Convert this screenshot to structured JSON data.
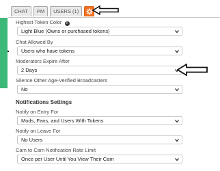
{
  "tabs": [
    {
      "label": "CHAT"
    },
    {
      "label": "PM"
    },
    {
      "label": "USERS (1)"
    },
    {
      "label": "",
      "icon": "gear-icon",
      "active": true,
      "color": "#f47321"
    }
  ],
  "settings": {
    "highest_token_color": {
      "label": "Highest Token Color",
      "value": "Light Blue (Owns or purchased tokens)"
    },
    "chat_allowed_by": {
      "label": "Chat Allowed By",
      "value": "Users who have tokens"
    },
    "moderators_expire_after": {
      "label": "Moderators Expire After",
      "value": "2 Days"
    },
    "silence_other_broadcasters": {
      "label": "Silence Other Age-Verified Broadcasters",
      "value": "No"
    }
  },
  "notifications": {
    "title": "Notifications Settings",
    "notify_on_entry": {
      "label": "Notify on Entry For",
      "value": "Mods, Fans, and Users With Tokens"
    },
    "notify_on_leave": {
      "label": "Notify on Leave For",
      "value": "No Users"
    },
    "cam_to_cam_rate": {
      "label": "Cam to Cam Notification Rate Limit",
      "value": "Once per User Until You View Their Cam"
    }
  },
  "colors": {
    "accent": "#f47321",
    "left_strip": "#3cb878"
  }
}
